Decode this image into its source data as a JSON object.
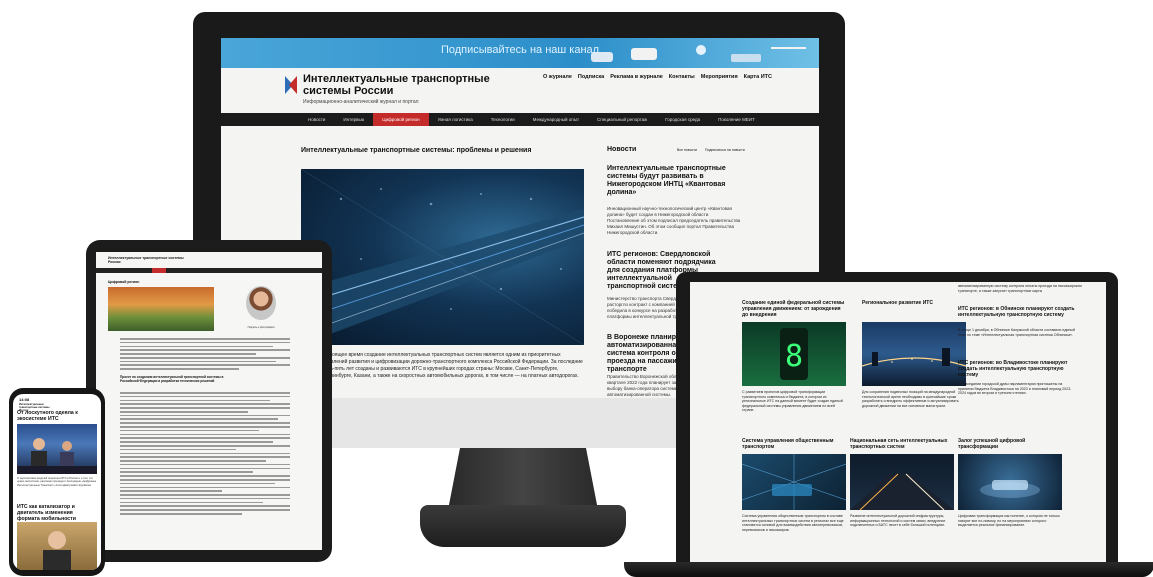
{
  "colors": {
    "accent_red": "#c42b2b",
    "banner_blue": "#2c8ec9",
    "nav_dark": "#1b1b1b"
  },
  "monitor": {
    "banner_text": "Подписывайтесь на наш канал",
    "site_title": "Интеллектуальные транспортные системы России",
    "tagline": "Информационно-аналитический журнал и портал",
    "top_nav": [
      "О журнале",
      "Подписка",
      "Реклама в журнале",
      "Контакты",
      "Мероприятия",
      "Карта ИТС"
    ],
    "main_nav": [
      "Новости",
      "Интервью",
      "Цифровой регион",
      "Умная логистика",
      "Технологии",
      "Международный опыт",
      "Специальный репортаж",
      "Городская среда",
      "Поколение МЕИТ"
    ],
    "active_nav": "Цифровой регион",
    "article_title": "Интеллектуальные транспортные системы: проблемы и решения",
    "article_body": "В настоящее время создание интеллектуальных транспортных систем является одним из приоритетных направлений развития и цифровизации дорожно-транспортного комплекса Российской Федерации. За последние десять-пять лет созданы и развиваются ИТС в крупнейших городах страны: Москве, Санкт-Петербурге, Екатеринбурге, Казани, а также на скоростных автомобильных дорогах, в том числе — на платных автодорогах.",
    "news_heading": "Новости",
    "news_links": [
      "Все новости",
      "Подписаться на новости"
    ],
    "news": [
      {
        "title": "Интеллектуальные транспортные системы будут развивать в Нижегородском ИНТЦ «Квантовая долина»",
        "body": "Инновационный научно-технологический центр «Квантовая долина» будет создан в Нижегородской области. Постановление об этом подписал председатель правительства Михаил Мишустин. Об этом сообщил портал Правительства Нижегородской области."
      },
      {
        "title": "ИТС регионов: Свердловской области поменяют подрядчика для создания платформы интеллектуальной транспортной системы",
        "body": "Министерство транспорта Свердловской области расторгло контракт с компанией «Элтех», которая победила в конкурсе на разработку единой платформы интеллектуальной транспортной системы."
      },
      {
        "title": "В Воронеже планируется автоматизированная система контроля оплаты проезда на пассажирском транспорте",
        "body": "Правительство Воронежской области в квартале 2022 года планирует запустить по выбору банка-оператора системы автоматизированной системы."
      }
    ]
  },
  "tablet": {
    "logo": "Интеллектуальные транспортные системы России",
    "section_title": "Цифровой регион",
    "photo_caption": "Подпись к фотографии",
    "subtitle": "Проект по созданию интеллектуальной транспортной системы в Российской Федерации и разработка технических решений"
  },
  "laptop": {
    "items": [
      {
        "title": "Создание единой федеральной системы управления движением: от зарождения до внедрения",
        "body": "С развитием проектов цифровой трансформации транспортного комплекса и бюджета, в котором их региональные ИТС на данный момент будет создан единый федеральный системы управления движением по всей стране."
      },
      {
        "title": "Региональное развитие ИТС",
        "body": "Для сохранения подвесных позиций на международной технологической арене необходимо в кратчайшие сроки разработать и внедрить эффективные и актуализировать дорожной движении на все основные магистрали."
      },
      {
        "title": "ИТС регионов: в Обнинске планируют создать интеллектуальную транспортную систему",
        "body": "В конце 1 декабря, в Обнинске Калужской области составили единый план по теме «Интеллектуальная транспортная система Обнинска»."
      },
      {
        "title": "ИТС регионов: во Владивостоке планируют создать интеллектуальную транспортную систему",
        "body": "На заседании городской думы парламентарии приглашены на принятии бюджета Владивостока на 2023 и плановый период 2023-2024 годов во втором и третьем чтениях."
      },
      {
        "title": "Система управления общественным транспортом",
        "body": "Система управления общественным транспортом в составе интеллектуальных транспортных систем в регионах все еще становится основой для взаимодействия автоперевозчиков, перевозчиков и пассажиров."
      },
      {
        "title": "Национальная сеть интеллектуальных транспортных систем",
        "body": "Развитие интеллектуальной дорожной инфраструктуры, информационных технологий и систем связи, внедрение подключенных и БАТС несет в себе большой потенциал."
      },
      {
        "title": "Залог успешной цифровой трансформации",
        "body": "Цифровая трансформация как понятие, о котором не только говорят все по-новому, но на мероприятиях которого выделяется реальное финансирование."
      }
    ],
    "top_text": "автоматизированную систему контроля оплаты проезда на пассажирском транспорте, а также запустит транспортные карты"
  },
  "phone": {
    "time": "14:08",
    "logo": "Интеллектуальные транспортные системы России",
    "headline1": "От лоскутного одеяла к экосистеме ИТС",
    "caption1": "О перспективах моделей оператора ИТС в России и о том, что нужно экосистеме, рассказал президент Ассоциации «Цифровые Интеллектуальные Транспорт» Антон Дмитриевич Журавлев",
    "headline2": "ИТС как катализатор и двигатель изменения формата мобильности"
  }
}
